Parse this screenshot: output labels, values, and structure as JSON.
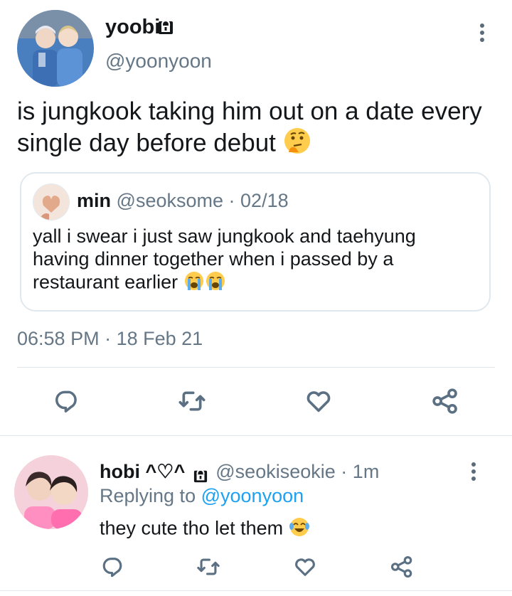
{
  "main_tweet": {
    "display_name": "yoobi",
    "handle": "@yoonyoon",
    "text": "is jungkook taking him out on a date every single day before debut",
    "emoji": "thinking-face",
    "timestamp": "06:58 PM",
    "separator": "·",
    "date": "18 Feb 21",
    "locked": true
  },
  "quoted_tweet": {
    "display_name": "min",
    "handle": "@seoksome",
    "separator": "·",
    "date": "02/18",
    "text": "yall i swear i just saw jungkook and taehyung having dinner together when i passed by a restaurant earlier",
    "emojis": [
      "loudly-crying-face",
      "loudly-crying-face"
    ]
  },
  "action_icons": [
    "reply-icon",
    "retweet-icon",
    "like-icon",
    "share-icon"
  ],
  "reply_tweet": {
    "display_name": "hobi ^♡^",
    "handle": "@seokiseokie",
    "separator": "·",
    "time_ago": "1m",
    "replying_prefix": "Replying to",
    "replying_to": "@yoonyoon",
    "text": "they cute tho let them",
    "emoji": "face-with-tears-of-joy",
    "locked": true
  },
  "colors": {
    "link": "#1da1f2",
    "muted": "#657786",
    "icon": "#5b7083",
    "divider": "#e1e8ed"
  }
}
